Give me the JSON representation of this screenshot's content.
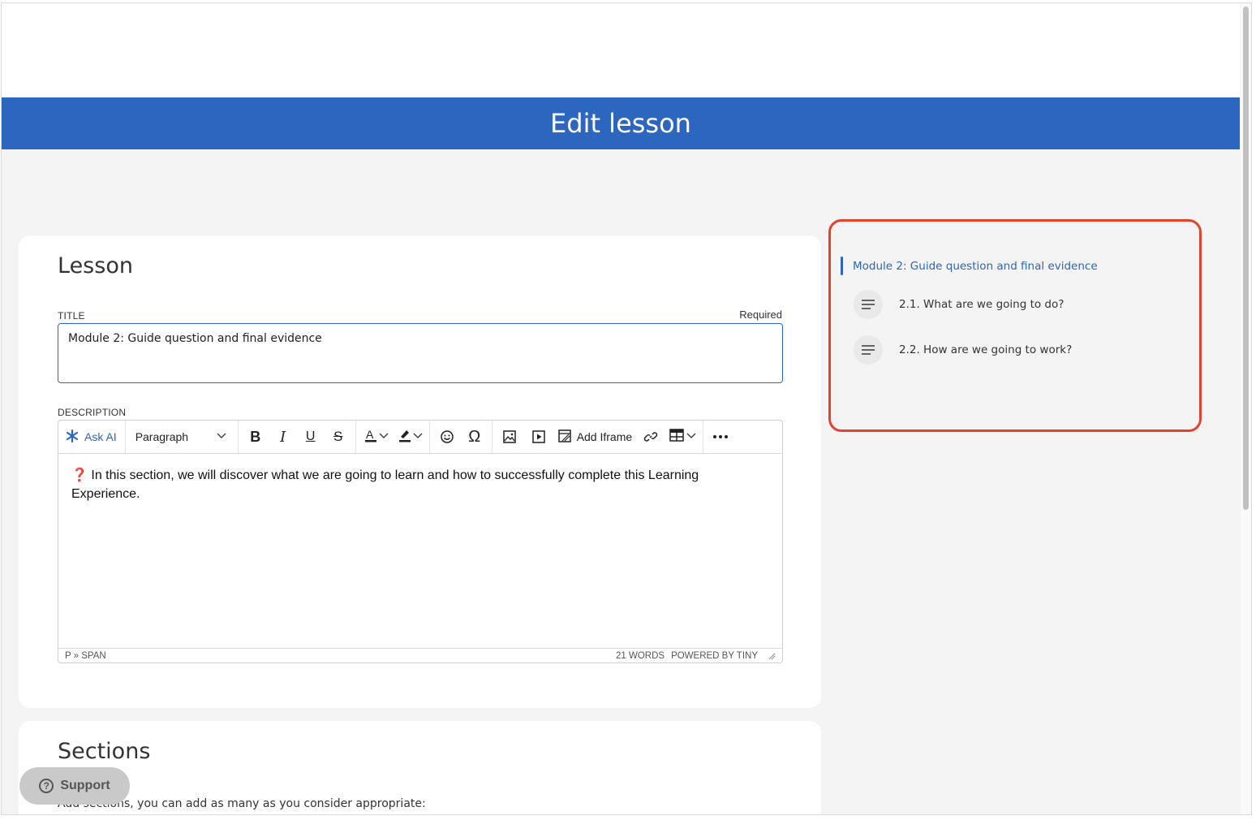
{
  "header": {
    "title": "Edit lesson"
  },
  "lesson": {
    "heading": "Lesson",
    "title_label": "TITLE",
    "required_label": "Required",
    "title_value": "Module 2: Guide question and final evidence",
    "description_label": "DESCRIPTION"
  },
  "editor": {
    "toolbar": {
      "ask_ai": "Ask AI",
      "paragraph": "Paragraph",
      "add_iframe": "Add Iframe"
    },
    "content_marker": "❓",
    "content": "In this section, we will discover what we are going to learn and how to successfully complete this Learning Experience.",
    "status_path": "P » SPAN",
    "word_count": "21 WORDS",
    "powered_by": "POWERED BY TINY"
  },
  "sections": {
    "heading": "Sections",
    "description": "Add sections, you can add as many as you consider appropriate:"
  },
  "outline": {
    "module": "Module 2: Guide question and final evidence",
    "items": [
      {
        "label": "2.1. What are we going to do?",
        "icon": "document-lines-icon"
      },
      {
        "label": "2.2. How are we going to work?",
        "icon": "document-lines-icon"
      }
    ]
  },
  "support": {
    "label": "Support"
  },
  "colors": {
    "brand": "#2c66bf",
    "highlight_border": "#e0432f",
    "background": "#f4f4f4"
  }
}
